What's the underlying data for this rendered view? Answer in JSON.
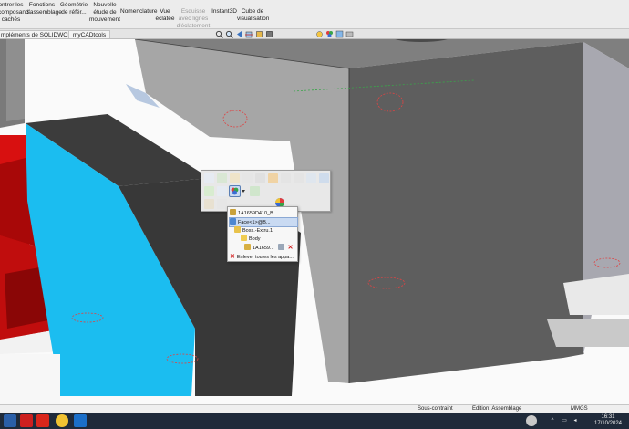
{
  "ribbon": {
    "items": [
      {
        "id": "show_hidden",
        "label": "ontrer les\ncomposants\ncachés"
      },
      {
        "id": "assembly_features",
        "label": "Fonctions\nd'assemblage"
      },
      {
        "id": "ref_geometry",
        "label": "Géométrie\nde référ..."
      },
      {
        "id": "new_motion_study",
        "label": "Nouvelle\nétude de\nmouvement"
      },
      {
        "id": "bom",
        "label": "Nomenclature"
      },
      {
        "id": "exploded_view",
        "label": "Vue\néclatée"
      },
      {
        "id": "sketch_lines",
        "label": "Esquisse\navec lignes\nd'éclatement"
      },
      {
        "id": "instant3d",
        "label": "Instant3D"
      },
      {
        "id": "view_cube",
        "label": "Cube de\nvisualisation"
      }
    ]
  },
  "tabs": [
    {
      "label": "mpléments de SOLIDWORKS"
    },
    {
      "label": "myCADtools"
    }
  ],
  "context_toolbar": {
    "selected": "appearance"
  },
  "selection_menu": {
    "items": [
      {
        "label": "1A1659D410_B...",
        "icon": "part-icon",
        "level": 0
      },
      {
        "label": "Face<1>@B...",
        "icon": "face-icon",
        "level": 0,
        "highlighted": true
      },
      {
        "label": "Boss.-Extru.1",
        "icon": "feature-icon",
        "level": 1
      },
      {
        "label": "Body",
        "icon": "body-icon",
        "level": 2
      },
      {
        "label": "1A1659...",
        "icon": "part-icon",
        "level": 3
      },
      {
        "label": "Enlever toutes les appa...",
        "icon": "remove-icon",
        "level": 0
      }
    ]
  },
  "statusbar": {
    "constraint": "Sous-contraint",
    "mode": "Edition: Assemblage",
    "units": "MMGS"
  },
  "taskbar": {
    "time": "16:31",
    "date": "17/10/2024"
  },
  "colors": {
    "accent_cyan": "#1bbdf0",
    "part_red": "#d81010",
    "part_gray": "#5e5e5e"
  }
}
